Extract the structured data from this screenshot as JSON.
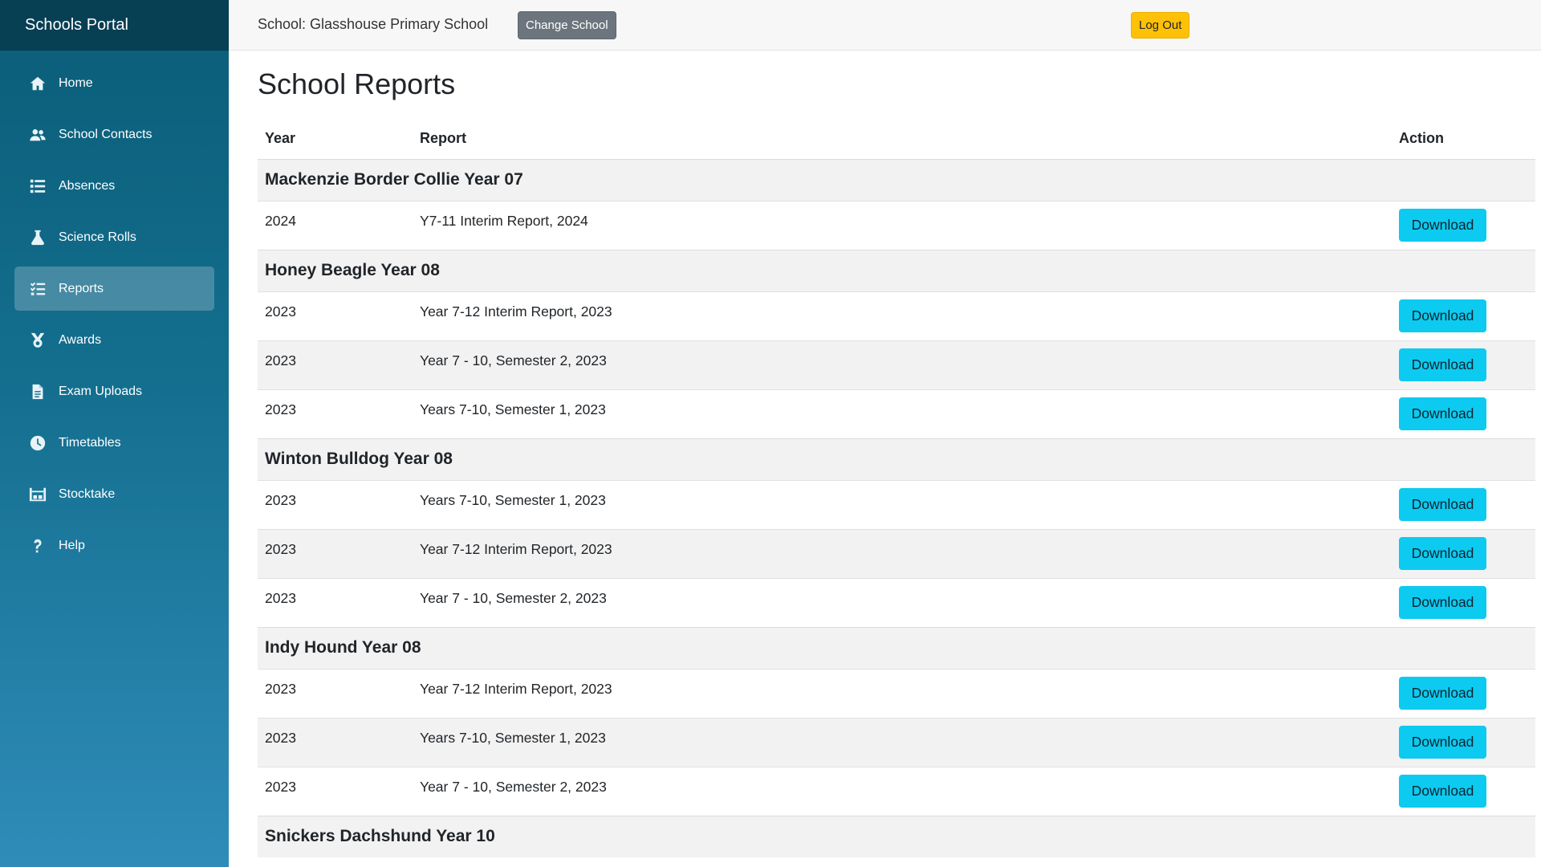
{
  "app": {
    "title": "Schools Portal"
  },
  "sidebar": {
    "items": [
      {
        "label": "Home",
        "icon": "home-icon",
        "active": false
      },
      {
        "label": "School Contacts",
        "icon": "users-icon",
        "active": false
      },
      {
        "label": "Absences",
        "icon": "list-icon",
        "active": false
      },
      {
        "label": "Science Rolls",
        "icon": "flask-icon",
        "active": false
      },
      {
        "label": "Reports",
        "icon": "tasks-icon",
        "active": true
      },
      {
        "label": "Awards",
        "icon": "award-icon",
        "active": false
      },
      {
        "label": "Exam Uploads",
        "icon": "file-icon",
        "active": false
      },
      {
        "label": "Timetables",
        "icon": "clock-icon",
        "active": false
      },
      {
        "label": "Stocktake",
        "icon": "warehouse-icon",
        "active": false
      },
      {
        "label": "Help",
        "icon": "question-icon",
        "active": false
      }
    ]
  },
  "header": {
    "school_label": "School: Glasshouse Primary School",
    "change_school_label": "Change School",
    "logout_label": "Log Out"
  },
  "page": {
    "title": "School Reports"
  },
  "table": {
    "headers": {
      "year": "Year",
      "report": "Report",
      "action": "Action"
    },
    "download_label": "Download",
    "groups": [
      {
        "student": "Mackenzie Border Collie Year 07",
        "reports": [
          {
            "year": "2024",
            "report": "Y7-11 Interim Report, 2024"
          }
        ]
      },
      {
        "student": "Honey Beagle Year 08",
        "reports": [
          {
            "year": "2023",
            "report": "Year 7-12 Interim Report, 2023"
          },
          {
            "year": "2023",
            "report": "Year 7 - 10, Semester 2, 2023"
          },
          {
            "year": "2023",
            "report": "Years 7-10, Semester 1, 2023"
          }
        ]
      },
      {
        "student": "Winton Bulldog Year 08",
        "reports": [
          {
            "year": "2023",
            "report": "Years 7-10, Semester 1, 2023"
          },
          {
            "year": "2023",
            "report": "Year 7-12 Interim Report, 2023"
          },
          {
            "year": "2023",
            "report": "Year 7 - 10, Semester 2, 2023"
          }
        ]
      },
      {
        "student": "Indy Hound Year 08",
        "reports": [
          {
            "year": "2023",
            "report": "Year 7-12 Interim Report, 2023"
          },
          {
            "year": "2023",
            "report": "Years 7-10, Semester 1, 2023"
          },
          {
            "year": "2023",
            "report": "Year 7 - 10, Semester 2, 2023"
          }
        ]
      },
      {
        "student": "Snickers Dachshund Year 10",
        "reports": []
      }
    ]
  },
  "colors": {
    "sidebar_top": "#0a5d78",
    "sidebar_bottom": "#2f8cb8",
    "brand_bar": "#073f53",
    "download_button": "#0dcaf0",
    "logout_button": "#ffc107",
    "change_school_button": "#6c757d"
  }
}
